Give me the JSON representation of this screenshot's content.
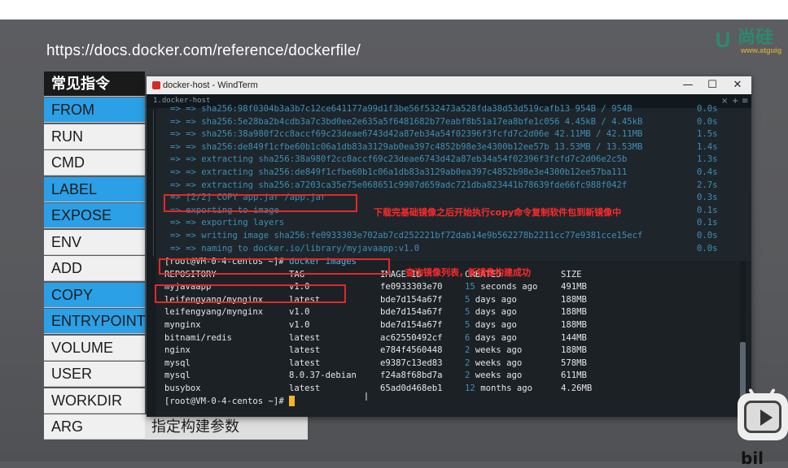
{
  "slide": {
    "url": "https://docs.docker.com/reference/dockerfile/",
    "logo": {
      "letter": "U",
      "brand": "尚硅",
      "site": "www.atguig"
    },
    "table_header": "常见指令",
    "instructions": [
      {
        "name": "FROM",
        "highlight": true
      },
      {
        "name": "RUN",
        "highlight": false
      },
      {
        "name": "CMD",
        "highlight": false
      },
      {
        "name": "LABEL",
        "highlight": true
      },
      {
        "name": "EXPOSE",
        "highlight": true
      },
      {
        "name": "ENV",
        "highlight": false
      },
      {
        "name": "ADD",
        "highlight": false
      },
      {
        "name": "COPY",
        "highlight": true
      },
      {
        "name": "ENTRYPOINT",
        "highlight": true
      },
      {
        "name": "VOLUME",
        "highlight": false
      },
      {
        "name": "USER",
        "highlight": false
      },
      {
        "name": "WORKDIR",
        "highlight": false
      },
      {
        "name": "ARG",
        "highlight": false
      }
    ],
    "arg_desc": "指定构建参数",
    "corner_text": "bil"
  },
  "window": {
    "title": "docker-host - WindTerm",
    "tab": "1.docker-host",
    "buttons": {
      "minimize": "—",
      "maximize": "☐",
      "close": "✕"
    },
    "tab_controls": {
      "close": "×",
      "add": "+",
      "menu": "≡"
    }
  },
  "terminal": {
    "build_lines": [
      {
        "text": "=> => sha256:98f0304b3a3b7c12ce641177a99d1f3be56f532473a528fda38d53d519cafb13 954B / 954B",
        "time": "0.0s"
      },
      {
        "text": "=> => sha256:5e28ba2b4cdb3a7c3bd0ee2e635a5f6481682b77eabf8b51a17ea8bfe1c056 4.45kB / 4.45kB",
        "time": "0.0s"
      },
      {
        "text": "=> => sha256:38a980f2cc8accf69c23deae6743d42a87eb34a54f02396f3fcfd7c2d06e 42.11MB / 42.11MB",
        "time": "1.5s"
      },
      {
        "text": "=> => sha256:de849f1cfbe60b1c06a1db83a3129ab0ea397c4852b98e3e4300b12ee57b 13.53MB / 13.53MB",
        "time": "1.4s"
      },
      {
        "text": "=> => extracting sha256:38a980f2cc8accf69c23deae6743d42a87eb34a54f02396f3fcfd7c2d06e2c5b",
        "time": "1.3s"
      },
      {
        "text": "=> => extracting sha256:de849f1cfbe60b1c06a1db83a3129ab0ea397c4852b98e3e4300b12ee57ba111",
        "time": "0.4s"
      },
      {
        "text": "=> => extracting sha256:a7203ca35e75e068651c9907d659adc721dba823441b78639fde66fc988f042f",
        "time": "2.7s"
      },
      {
        "text": "=> [2/2] COPY app.jar /app.jar",
        "time": "0.3s"
      },
      {
        "text": "=> exporting to image",
        "time": "0.1s"
      },
      {
        "text": "=> => exporting layers",
        "time": "0.1s"
      },
      {
        "text": "=> => writing image sha256:fe0933303e702ab7cd252221bf72dab14e9b562278b2211cc77e9381cce15ecf",
        "time": "0.0s"
      },
      {
        "text": "=> => naming to docker.io/library/myjavaapp:v1.0",
        "time": "0.0s"
      }
    ],
    "prompt": "[root@VM-0-4-centos ~]#",
    "command": "docker images",
    "headers": {
      "repository": "REPOSITORY",
      "tag": "TAG",
      "image_id": "IMAGE ID",
      "created_num": "CREATED",
      "created_rest": "",
      "size": "SIZE"
    },
    "images": [
      {
        "repository": "myjavaapp",
        "tag": "v1.0",
        "image_id": "fe0933303e70",
        "created_num": "15",
        "created_rest": "seconds ago",
        "size": "491MB"
      },
      {
        "repository": "leifengyang/mynginx",
        "tag": "latest",
        "image_id": "bde7d154a67f",
        "created_num": "5",
        "created_rest": "days ago",
        "size": "188MB"
      },
      {
        "repository": "leifengyang/mynginx",
        "tag": "v1.0",
        "image_id": "bde7d154a67f",
        "created_num": "5",
        "created_rest": "days ago",
        "size": "188MB"
      },
      {
        "repository": "mynginx",
        "tag": "v1.0",
        "image_id": "bde7d154a67f",
        "created_num": "5",
        "created_rest": "days ago",
        "size": "188MB"
      },
      {
        "repository": "bitnami/redis",
        "tag": "latest",
        "image_id": "ac62550492cf",
        "created_num": "6",
        "created_rest": "days ago",
        "size": "144MB"
      },
      {
        "repository": "nginx",
        "tag": "latest",
        "image_id": "e784f4560448",
        "created_num": "2",
        "created_rest": "weeks ago",
        "size": "188MB"
      },
      {
        "repository": "mysql",
        "tag": "latest",
        "image_id": "e9387c13ed83",
        "created_num": "2",
        "created_rest": "weeks ago",
        "size": "578MB"
      },
      {
        "repository": "mysql",
        "tag": "8.0.37-debian",
        "image_id": "f24a8f68bd7a",
        "created_num": "2",
        "created_rest": "weeks ago",
        "size": "611MB"
      },
      {
        "repository": "busybox",
        "tag": "latest",
        "image_id": "65ad0d468eb1",
        "created_num": "12",
        "created_rest": "months ago",
        "size": "4.26MB"
      }
    ],
    "final_prompt": "[root@VM-0-4-centos ~]#"
  },
  "annotations": {
    "copy_note": "下载完基础镜像之后开始执行copy命令复制软件包到新镜像中",
    "images_note": "查询镜像列表，新镜像构建成功"
  },
  "colors": {
    "highlight": "#2ba0e6",
    "annotation": "#e02a2a",
    "cursor": "#f0b429",
    "terminal_dim": "#3f8fb6"
  }
}
